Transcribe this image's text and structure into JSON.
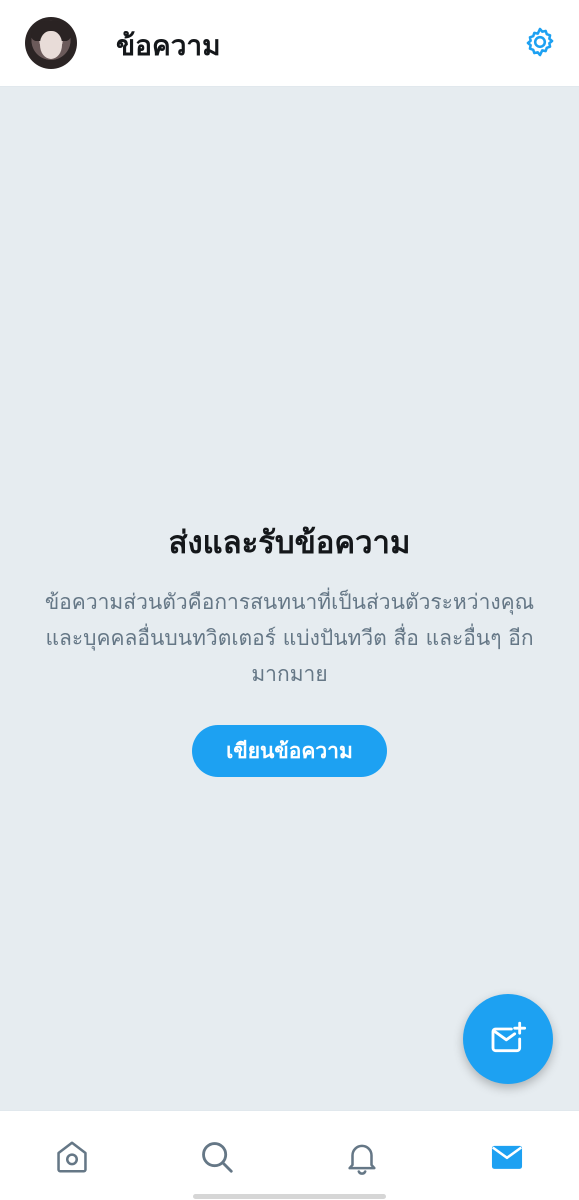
{
  "header": {
    "title": "ข้อความ",
    "avatar_icon": "user-avatar",
    "settings_icon": "gear-icon"
  },
  "empty_state": {
    "title": "ส่งและรับข้อความ",
    "description": "ข้อความส่วนตัวคือการสนทนาที่เป็นส่วนตัวระหว่างคุณและบุคคลอื่นบนทวิตเตอร์ แบ่งปันทวีต สื่อ และอื่นๆ อีกมากมาย",
    "button_label": "เขียนข้อความ"
  },
  "fab": {
    "icon": "new-message-icon"
  },
  "bottom_nav": {
    "items": [
      {
        "name": "home",
        "icon": "home-icon",
        "active": false
      },
      {
        "name": "search",
        "icon": "search-icon",
        "active": false
      },
      {
        "name": "notifications",
        "icon": "bell-icon",
        "active": false
      },
      {
        "name": "messages",
        "icon": "mail-icon",
        "active": true
      }
    ]
  },
  "colors": {
    "accent": "#1da1f2",
    "background": "#e6ecf0",
    "text_primary": "#14171a",
    "text_secondary": "#657786",
    "icon_inactive": "#657786"
  }
}
